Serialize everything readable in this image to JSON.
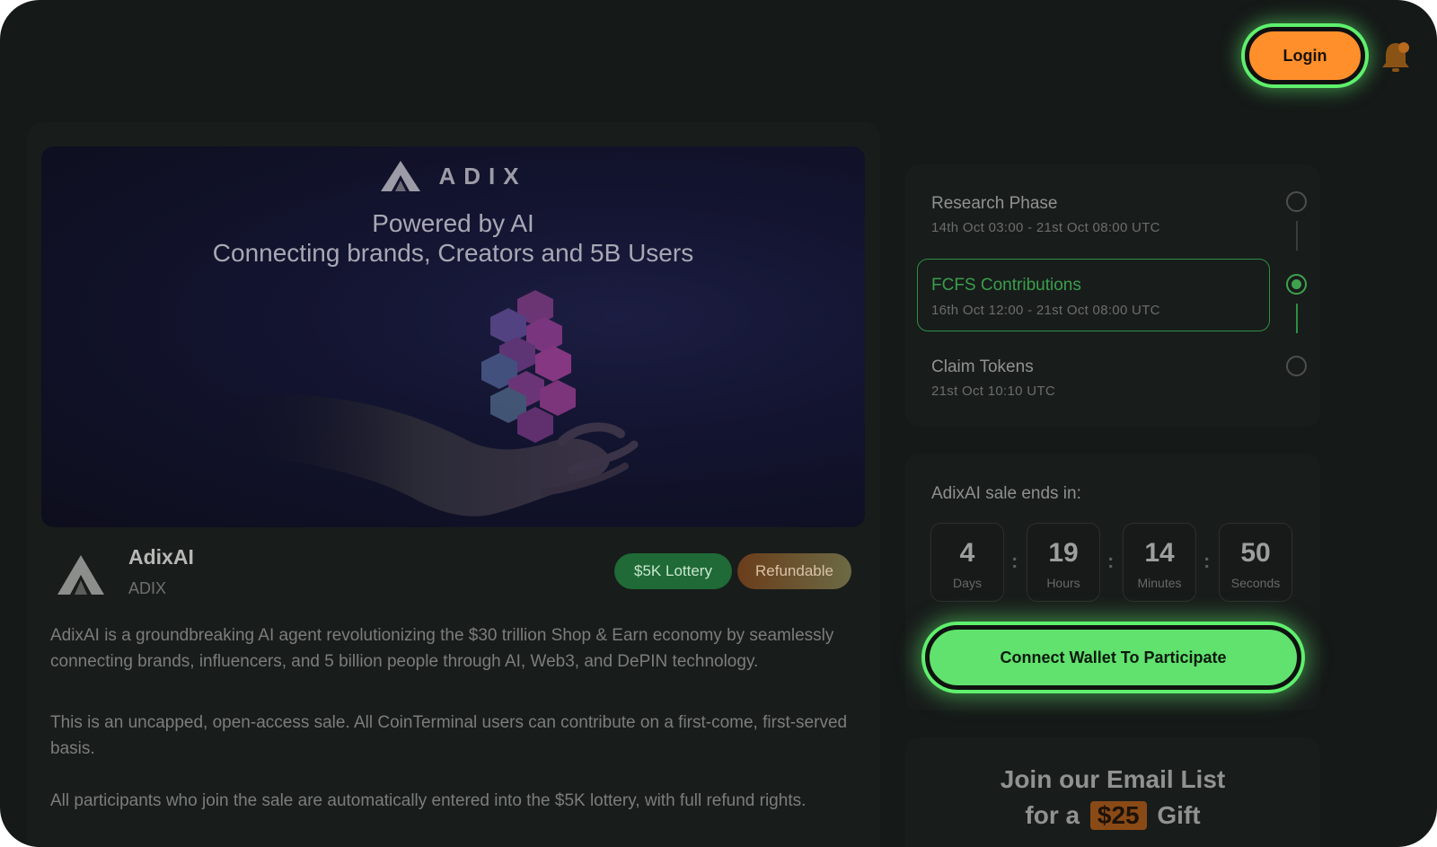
{
  "header": {
    "login_label": "Login",
    "bell_icon": "bell-icon"
  },
  "banner": {
    "brand": "ADIX",
    "tagline_1": "Powered by AI",
    "tagline_2": "Connecting brands, Creators and 5B Users"
  },
  "project": {
    "name": "AdixAI",
    "ticker": "ADIX",
    "badges": [
      "$5K Lottery",
      "Refundable"
    ],
    "description": [
      "AdixAI is a groundbreaking AI agent revolutionizing the $30 trillion Shop & Earn economy by seamlessly connecting brands, influencers, and 5 billion people through AI, Web3, and DePIN technology.",
      "This is an uncapped, open-access sale. All CoinTerminal users can contribute on a first-come, first-served basis.",
      "All participants who join the sale are automatically entered into the $5K lottery, with full refund rights."
    ]
  },
  "phases": [
    {
      "title": "Research Phase",
      "date": "14th Oct 03:00 - 21st Oct 08:00 UTC",
      "active": false
    },
    {
      "title": "FCFS Contributions",
      "date": "16th Oct 12:00 - 21st Oct 08:00 UTC",
      "active": true
    },
    {
      "title": "Claim Tokens",
      "date": "21st Oct 10:10 UTC",
      "active": false
    }
  ],
  "countdown": {
    "label": "AdixAI sale ends in:",
    "units": [
      {
        "value": "4",
        "unit": "Days"
      },
      {
        "value": "19",
        "unit": "Hours"
      },
      {
        "value": "14",
        "unit": "Minutes"
      },
      {
        "value": "50",
        "unit": "Seconds"
      }
    ],
    "separator": ":"
  },
  "connect_label": "Connect Wallet To Participate",
  "email": {
    "line1": "Join our Email List",
    "line2_prefix": "for a",
    "gift_amount": "$25",
    "line2_suffix": "Gift"
  },
  "colors": {
    "accent_green": "#5ff06d",
    "login_orange": "#ff8f2b",
    "active_phase": "#3fa24f"
  }
}
